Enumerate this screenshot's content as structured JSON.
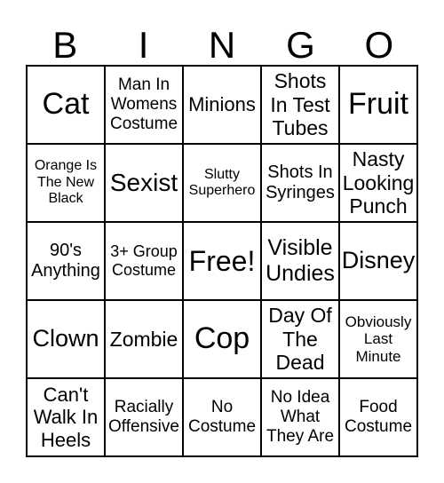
{
  "header": [
    "B",
    "I",
    "N",
    "G",
    "O"
  ],
  "cells": [
    [
      "Cat",
      "Man In Womens Costume",
      "Minions",
      "Shots In Test Tubes",
      "Fruit"
    ],
    [
      "Orange Is The New Black",
      "Sexist",
      "Slutty Superhero",
      "Shots In Syringes",
      "Nasty Looking Punch"
    ],
    [
      "90's Anything",
      "3+ Group Costume",
      "Free!",
      "Visible Undies",
      "Disney"
    ],
    [
      "Clown",
      "Zombie",
      "Cop",
      "Day Of The Dead",
      "Obviously Last Minute"
    ],
    [
      "Can't Walk In Heels",
      "Racially Offensive",
      "No Costume",
      "No Idea What They Are",
      "Food Costume"
    ]
  ]
}
